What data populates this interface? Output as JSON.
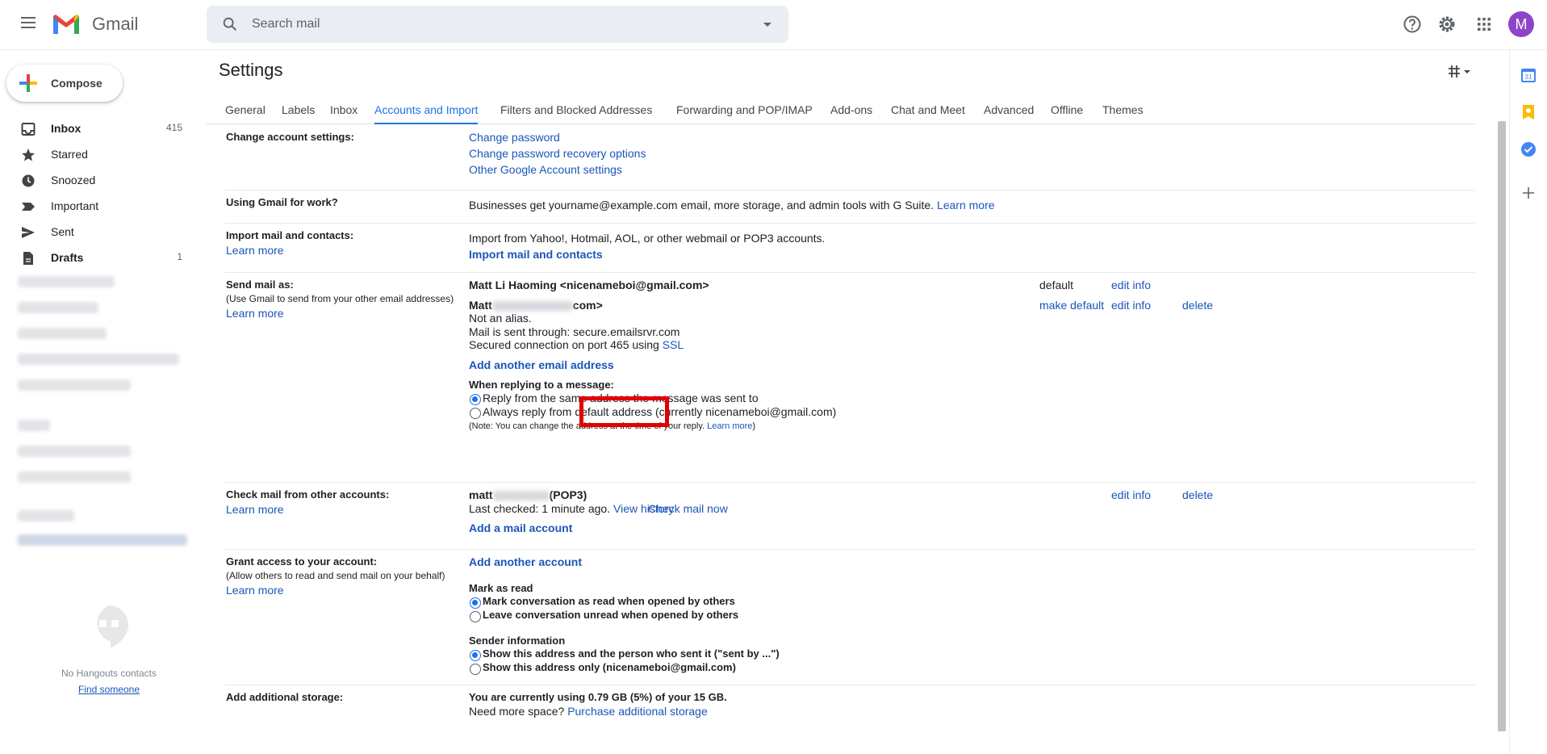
{
  "header": {
    "app_name": "Gmail",
    "search_placeholder": "Search mail",
    "avatar_letter": "M",
    "brand_color": "#ea4335",
    "avatar_color": "#8e44c8"
  },
  "sidebar": {
    "compose_label": "Compose",
    "items": [
      {
        "label": "Inbox",
        "count": "415",
        "icon": "inbox-icon",
        "bold": true
      },
      {
        "label": "Starred",
        "count": "",
        "icon": "star-icon"
      },
      {
        "label": "Snoozed",
        "count": "",
        "icon": "clock-icon"
      },
      {
        "label": "Important",
        "count": "",
        "icon": "important-icon"
      },
      {
        "label": "Sent",
        "count": "",
        "icon": "send-icon"
      },
      {
        "label": "Drafts",
        "count": "1",
        "icon": "draft-icon",
        "bold": true
      }
    ],
    "hangouts_text": "No Hangouts contacts",
    "find_someone": "Find someone"
  },
  "main": {
    "title": "Settings",
    "tabs": [
      {
        "label": "General"
      },
      {
        "label": "Labels"
      },
      {
        "label": "Inbox"
      },
      {
        "label": "Accounts and Import",
        "active": true
      },
      {
        "label": "Filters and Blocked Addresses"
      },
      {
        "label": "Forwarding and POP/IMAP"
      },
      {
        "label": "Add-ons"
      },
      {
        "label": "Chat and Meet"
      },
      {
        "label": "Advanced"
      },
      {
        "label": "Offline"
      },
      {
        "label": "Themes"
      }
    ]
  },
  "sections": {
    "change_account": {
      "label": "Change account settings:",
      "links": [
        "Change password",
        "Change password recovery options",
        "Other Google Account settings"
      ]
    },
    "work": {
      "label": "Using Gmail for work?",
      "text": "Businesses get yourname@example.com email, more storage, and admin tools with G Suite.",
      "learn_more": "Learn more"
    },
    "import": {
      "label": "Import mail and contacts:",
      "learn_more": "Learn more",
      "text": "Import from Yahoo!, Hotmail, AOL, or other webmail or POP3 accounts.",
      "action": "Import mail and contacts"
    },
    "send_as": {
      "label": "Send mail as:",
      "sub": "(Use Gmail to send from your other email addresses)",
      "learn_more": "Learn more",
      "primary": "Matt Li Haoming <nicenameboi@gmail.com>",
      "primary_status": "default",
      "edit_info": "edit info",
      "alias_prefix": "Matt",
      "alias_suffix": "com>",
      "make_default": "make default",
      "delete": "delete",
      "alias_line1": "Not an alias.",
      "alias_line2": "Mail is sent through: secure.emailsrvr.com",
      "alias_line3": "Secured connection on port 465 using",
      "ssl": "SSL",
      "add_address": "Add another email address",
      "replying_heading": "When replying to a message:",
      "reply_option1": "Reply from the same address the message was sent to",
      "reply_option2": "Always reply from default address (currently nicenameboi@gmail.com)",
      "note": "(Note: You can change the address at the time of your reply.",
      "note_link": "Learn more",
      "note_end": ")"
    },
    "check_mail": {
      "label": "Check mail from other accounts:",
      "learn_more": "Learn more",
      "account_prefix": "matt",
      "account_suffix": "(POP3)",
      "last_checked": "Last checked: 1 minute ago.",
      "view_history": "View history",
      "check_now": "Check mail now",
      "add_account": "Add a mail account",
      "edit_info": "edit info",
      "delete": "delete"
    },
    "grant": {
      "label": "Grant access to your account:",
      "sub": "(Allow others to read and send mail on your behalf)",
      "learn_more": "Learn more",
      "add_account": "Add another account",
      "mark_heading": "Mark as read",
      "mark_option1": "Mark conversation as read when opened by others",
      "mark_option2": "Leave conversation unread when opened by others",
      "sender_heading": "Sender information",
      "sender_option1": "Show this address and the person who sent it (\"sent by ...\")",
      "sender_option2": "Show this address only (nicenameboi@gmail.com)"
    },
    "storage": {
      "label": "Add additional storage:",
      "usage": "You are currently using 0.79 GB (5%) of your 15 GB.",
      "need_more": "Need more space?",
      "purchase": "Purchase additional storage"
    }
  }
}
